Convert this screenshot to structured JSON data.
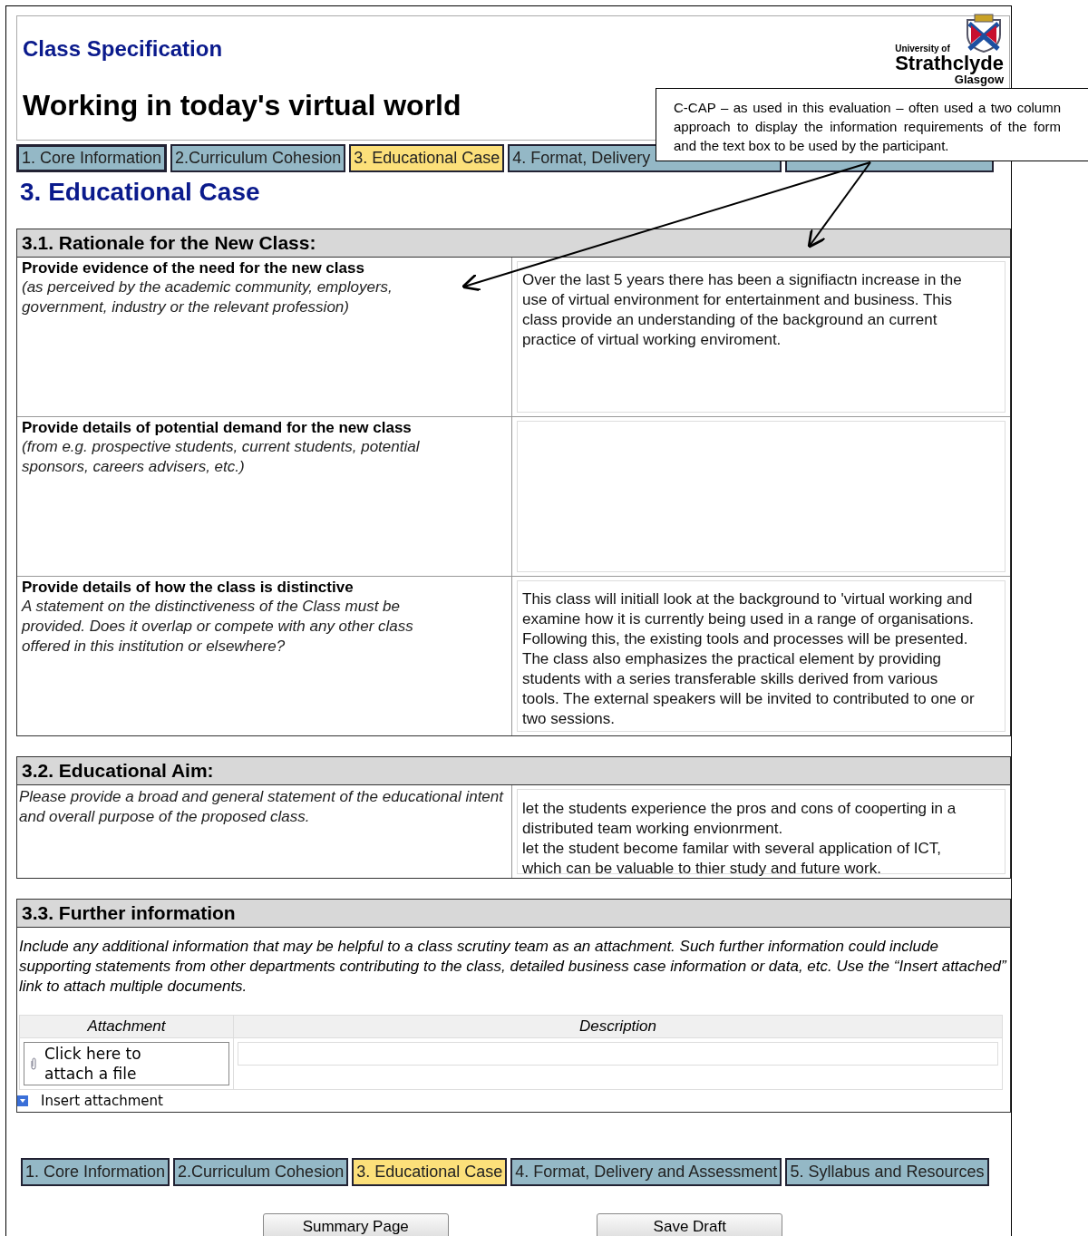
{
  "header": {
    "subtitle": "Class Specification",
    "title": "Working in today's virtual world",
    "logo": {
      "small": "University of",
      "name": "Strathclyde",
      "city": "Glasgow"
    }
  },
  "top_tabs": [
    {
      "label": "1. Core Information",
      "selected": false
    },
    {
      "label": "2.Curriculum Cohesion",
      "selected": false
    },
    {
      "label": "3. Educational Case",
      "selected": true
    },
    {
      "label": "4. Format, Delivery",
      "selected": false
    },
    {
      "selected": false
    }
  ],
  "page_heading": "3. Educational Case",
  "sections": [
    {
      "title": "3.1. Rationale for the New Class:",
      "rows": [
        {
          "label": "Provide evidence of the need for the new class",
          "hint": "(as perceived by the academic community, employers, government, industry or the relevant profession)",
          "value": "Over the last 5 years there has been a signifiactn increase in the use of virtual environment for entertainment and business. This class provide an understanding of the background an current practice of virtual working enviroment."
        },
        {
          "label": "Provide details of potential demand for the new class",
          "hint": "(from e.g. prospective students, current students, potential sponsors, careers advisers, etc.)"
        },
        {
          "label": "Provide details of how the class is distinctive",
          "hint": "A statement on the distinctiveness of the Class must be provided. Does it overlap or compete with any other class offered in this institution or elsewhere?",
          "value": "This class will initiall look at the background to 'virtual working and examine how it is currently being used in a range of organisations. Following this, the existing tools and processes will be presented. The class also emphasizes the practical element by providing students with a series transferable skills derived from various tools. The external speakers will be invited to contributed to one or two sessions."
        }
      ]
    },
    {
      "title": "3.2. Educational Aim:",
      "rows": [
        {
          "hint": "Please provide a broad and general statement of the educational intent and overall purpose of the proposed class.",
          "value": "let the students experience the pros and cons of cooperting in a distributed team working envionrment.\nlet the student become familar with several application of ICT, which can be valuable to thier study and future work."
        }
      ]
    }
  ],
  "further": {
    "title": "3.3. Further information",
    "text": "Include any additional information that may be helpful to a class scrutiny team as an attachment.  Such further information could include supporting statements from other departments contributing to the class, detailed business case information or data, etc.  Use the “Insert attached” link to attach multiple documents.",
    "columns": [
      "Attachment",
      "Description"
    ],
    "attach_link": "Click here to attach a file",
    "insert_link": "Insert attachment"
  },
  "bottom_tabs": [
    {
      "label": "1. Core Information",
      "selected": false
    },
    {
      "label": "2.Curriculum Cohesion",
      "selected": false
    },
    {
      "label": "3. Educational Case",
      "selected": true
    },
    {
      "label": "4. Format, Delivery and Assessment",
      "selected": false
    },
    {
      "label": "5. Syllabus and Resources",
      "selected": false
    }
  ],
  "buttons": [
    "Summary Page",
    "Save Draft"
  ],
  "callout": {
    "text": "C-CAP – as used in this evaluation – often used a two column approach to display the information requirements of the form and the text box to be used by the participant."
  }
}
